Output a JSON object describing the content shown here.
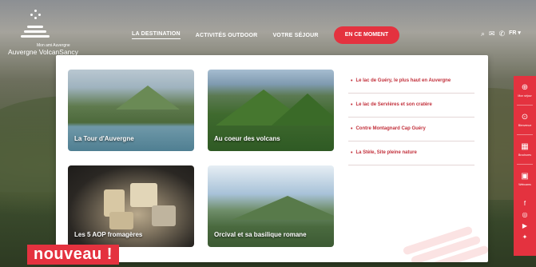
{
  "logo": {
    "small_text": "Mon ami Auvergne",
    "name": "Auvergne VolcanSancy"
  },
  "nav": {
    "items": [
      "LA DESTINATION",
      "ACTIVITÉS OUTDOOR",
      "VOTRE SÉJOUR"
    ],
    "cta": "EN CE MOMENT"
  },
  "utils": {
    "search_icon": "⌕",
    "mail_icon": "✉",
    "phone_icon": "✆",
    "lang": "FR ▾"
  },
  "menu": {
    "cards": [
      {
        "caption": "La Tour d'Auvergne"
      },
      {
        "caption": "Au coeur des volcans"
      },
      {
        "caption": "Les 5 AOP fromagères"
      },
      {
        "caption": "Orcival et sa basilique romane"
      }
    ],
    "links": [
      "Le lac de Guéry, le plus haut en Auvergne",
      "Le lac de Servières et son cratère",
      "Contre Montagnard Cap Guéry",
      "La Stèle, Site pleine nature"
    ],
    "link_bullet": "•"
  },
  "sidebar": {
    "items": [
      {
        "icon": "⊕",
        "label": "Mon séjour"
      },
      {
        "icon": "⊙",
        "label": "Bienvenue"
      },
      {
        "icon": "▦",
        "label": "Brochures"
      },
      {
        "icon": "▣",
        "label": "Webcams"
      }
    ],
    "social": [
      "f",
      "◎",
      "▶",
      "✦"
    ]
  },
  "badge": "nouveau !",
  "colors": {
    "accent": "#e4323f",
    "link": "#c2303b"
  }
}
